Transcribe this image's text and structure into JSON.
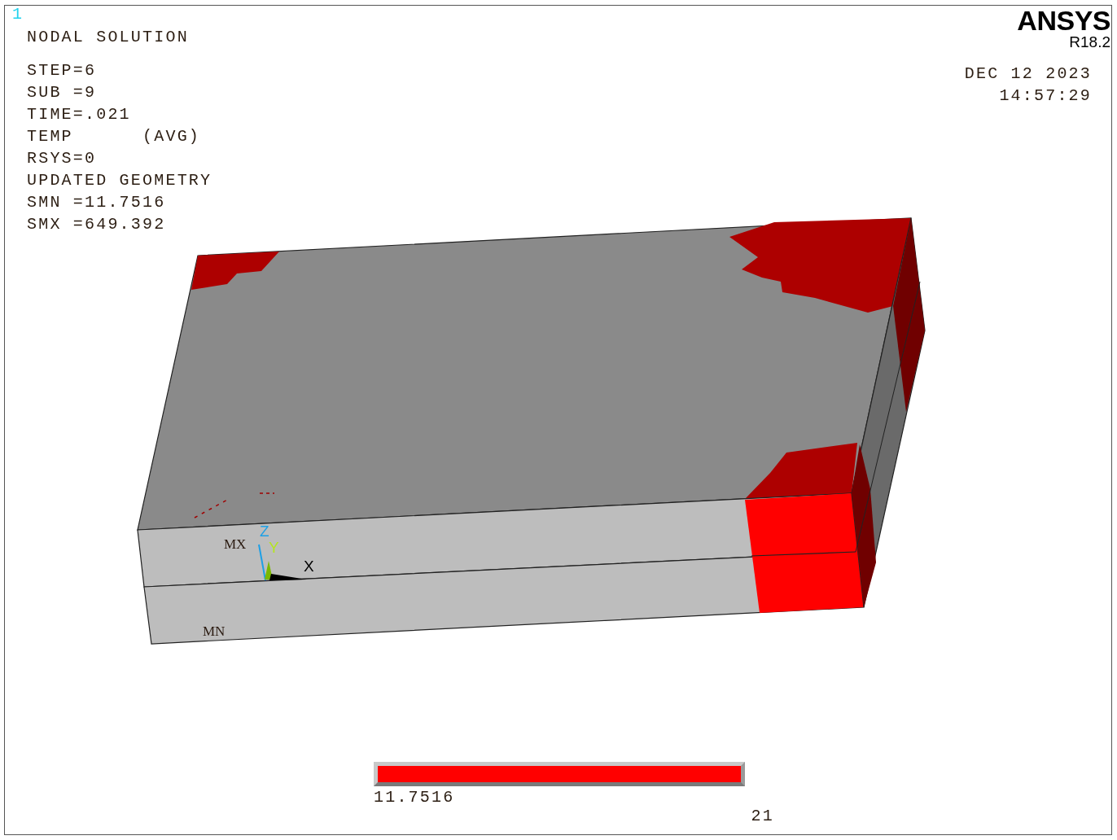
{
  "window_number": "1",
  "title": "NODAL SOLUTION",
  "info_lines": [
    "STEP=6",
    "SUB =9",
    "TIME=.021",
    "TEMP      (AVG)",
    "RSYS=0",
    "UPDATED GEOMETRY",
    "SMN =11.7516",
    "SMX =649.392"
  ],
  "logo": "ANSYS",
  "version": "R18.2",
  "date": "DEC 12 2023",
  "time": "14:57:29",
  "plot_labels": [
    {
      "kind": "max",
      "text": "MX"
    },
    {
      "kind": "min",
      "text": "MN"
    },
    {
      "kind": "axis_z",
      "text": "Z",
      "color": "#1ea0e6"
    },
    {
      "kind": "axis_y",
      "text": "Y",
      "color": "#b4e61e"
    },
    {
      "kind": "axis_x",
      "text": "X",
      "color": "#000000"
    }
  ],
  "legend": {
    "min_label": "11.7516",
    "max_label": "21"
  }
}
